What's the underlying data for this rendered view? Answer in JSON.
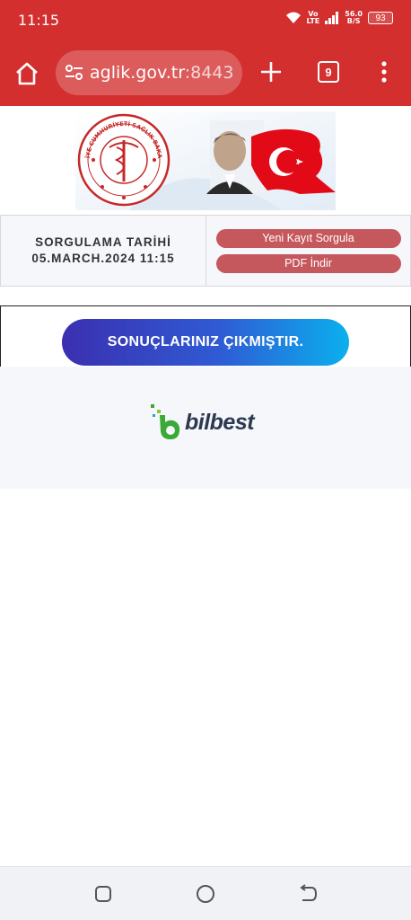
{
  "status_bar": {
    "time": "11:15",
    "volte_top": "Vo",
    "volte_bottom": "LTE",
    "speed_value": "56.0",
    "speed_unit": "B/S",
    "battery": "93"
  },
  "browser": {
    "url_main": "aglik.gov.tr",
    "url_port": ":8443",
    "tab_count": "9"
  },
  "banner": {
    "emblem_text": "TÜRKİYE CUMHURİYETİ SAĞLIK BAKANLIĞI"
  },
  "info": {
    "label": "SORGULAMA TARİHİ",
    "date": "05.MARCH.2024 11:15",
    "buttons": {
      "new_query": "Yeni Kayıt Sorgula",
      "pdf": "PDF İndir"
    }
  },
  "result": {
    "label": "SONUÇLARINIZ ÇIKMIŞTIR."
  },
  "brand": {
    "name": "bilbest"
  },
  "colors": {
    "browser_red": "#d32f2f",
    "button_red": "#c5585c",
    "gradient_start": "#3b2fb0",
    "gradient_end": "#0ab0ee",
    "brand_green": "#3aa935"
  }
}
